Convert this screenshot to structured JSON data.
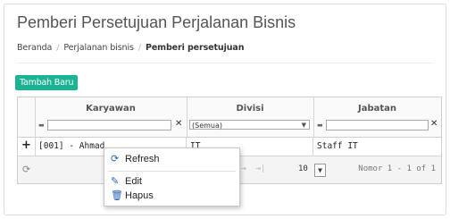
{
  "page": {
    "title": "Pemberi Persetujuan Perjalanan Bisnis"
  },
  "breadcrumb": {
    "home": "Beranda",
    "parent": "Perjalanan bisnis",
    "current": "Pemberi persetujuan"
  },
  "toolbar": {
    "add_label": "Tambah Baru"
  },
  "grid": {
    "columns": [
      {
        "label": "Karyawan",
        "filter_type": "text",
        "filter_value": ""
      },
      {
        "label": "Divisi",
        "filter_type": "select",
        "filter_value": "(Semua)"
      },
      {
        "label": "Jabatan",
        "filter_type": "text",
        "filter_value": ""
      }
    ],
    "rows": [
      {
        "karyawan": "[001] - Ahmad",
        "divisi": "IT",
        "jabatan": "Staff IT"
      }
    ],
    "expander": "+",
    "pager": {
      "page_text": "1",
      "rows_per_page": "10",
      "record_info": "Nomor 1 - 1 of 1"
    }
  },
  "context_menu": {
    "items": [
      {
        "label": "Refresh",
        "icon": "refresh-icon"
      },
      {
        "label": "Edit",
        "icon": "edit-icon"
      },
      {
        "label": "Hapus",
        "icon": "trash-icon"
      }
    ]
  },
  "colors": {
    "accent": "#1ab394",
    "menu_icon": "#2a62b8"
  }
}
